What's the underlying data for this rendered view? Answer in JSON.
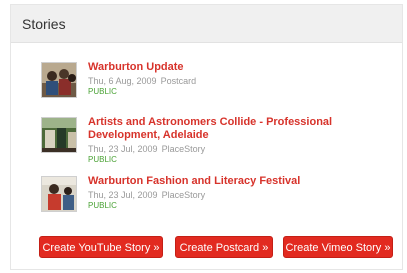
{
  "section": {
    "title": "Stories"
  },
  "stories": [
    {
      "title": "Warburton Update",
      "date": "Thu, 6 Aug, 2009",
      "type": "Postcard",
      "status": "PUBLIC"
    },
    {
      "title": "Artists and Astronomers Collide - Professional Development, Adelaide",
      "date": "Thu, 23 Jul, 2009",
      "type": "PlaceStory",
      "status": "PUBLIC"
    },
    {
      "title": "Warburton Fashion and Literacy Festival",
      "date": "Thu, 23 Jul, 2009",
      "type": "PlaceStory",
      "status": "PUBLIC"
    }
  ],
  "actions": {
    "youtube": "Create YouTube Story »",
    "postcard": "Create Postcard »",
    "vimeo": "Create Vimeo Story »"
  },
  "colors": {
    "accent": "#e22a20",
    "title_link": "#d7332b",
    "status": "#4aa235"
  }
}
